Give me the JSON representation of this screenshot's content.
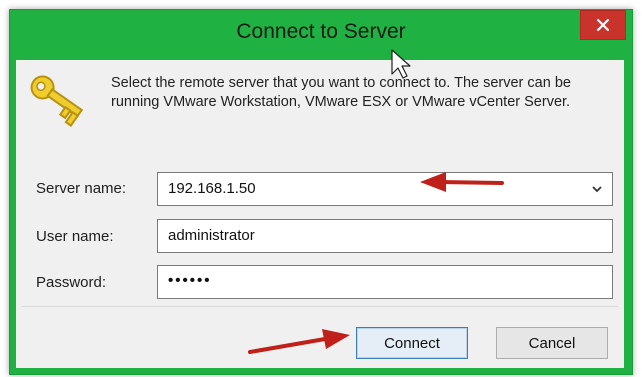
{
  "window": {
    "title": "Connect to Server"
  },
  "dialog": {
    "description": "Select the remote server that you want to connect to. The server can be running VMware Workstation, VMware ESX or VMware vCenter Server.",
    "server": {
      "label": "Server name:",
      "value": "192.168.1.50"
    },
    "user": {
      "label": "User name:",
      "value": "administrator"
    },
    "password": {
      "label": "Password:",
      "value": "••••••"
    },
    "buttons": {
      "connect": "Connect",
      "cancel": "Cancel"
    }
  },
  "colors": {
    "title_bar": "#1fb142",
    "close_button": "#c9332c",
    "annotation_arrow": "#c0201a",
    "key_icon": "#e8c21a"
  },
  "icons": [
    "close-icon",
    "key-icon",
    "chevron-down-icon",
    "cursor-icon",
    "arrow-annotation-icon"
  ]
}
